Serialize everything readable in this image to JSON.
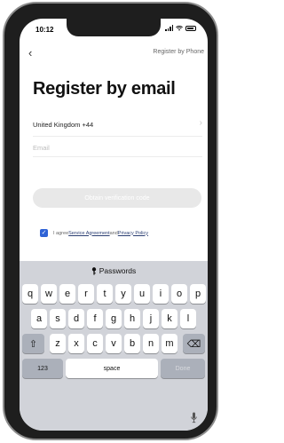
{
  "status_bar": {
    "time": "10:12"
  },
  "nav": {
    "back_label": "‹",
    "right_link": "Register by Phone"
  },
  "page": {
    "title": "Register by email",
    "country_value": "United Kingdom +44",
    "country_chevron": "›",
    "email_placeholder": "Email",
    "obtain_button": "Obtain verification code"
  },
  "agreement": {
    "checked": true,
    "check_glyph": "✓",
    "prefix": "I agree ",
    "service_link": "Service Agreement",
    "and": " and ",
    "privacy_link": "Privacy Policy"
  },
  "keyboard": {
    "suggestion_bar": "Passwords",
    "row1": [
      "q",
      "w",
      "e",
      "r",
      "t",
      "y",
      "u",
      "i",
      "o",
      "p"
    ],
    "row2": [
      "a",
      "s",
      "d",
      "f",
      "g",
      "h",
      "j",
      "k",
      "l"
    ],
    "row3": [
      "z",
      "x",
      "c",
      "v",
      "b",
      "n",
      "m"
    ],
    "shift_glyph": "⇧",
    "delete_glyph": "⌫",
    "numbers_key": "123",
    "space_key": "space",
    "done_key": "Done"
  },
  "colors": {
    "accent": "#2f63d6",
    "button_disabled": "#e8e8e8",
    "keyboard_bg": "#d1d3d9"
  }
}
